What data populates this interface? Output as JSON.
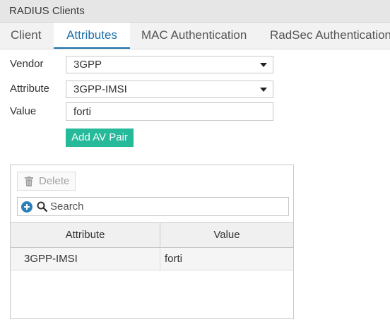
{
  "window": {
    "title": "RADIUS Clients"
  },
  "tabs": [
    {
      "label": "Client",
      "active": false
    },
    {
      "label": "Attributes",
      "active": true
    },
    {
      "label": "MAC Authentication",
      "active": false
    },
    {
      "label": "RadSec Authentication",
      "active": false
    }
  ],
  "form": {
    "vendor_label": "Vendor",
    "vendor_value": "3GPP",
    "attribute_label": "Attribute",
    "attribute_value": "3GPP-IMSI",
    "value_label": "Value",
    "value_value": "forti",
    "add_button_label": "Add AV Pair"
  },
  "table": {
    "delete_label": "Delete",
    "search_placeholder": "Search",
    "columns": [
      "Attribute",
      "Value"
    ],
    "rows": [
      {
        "attribute": "3GPP-IMSI",
        "value": "forti"
      }
    ]
  },
  "icons": {
    "delete": "trash-icon",
    "add": "plus-circle-icon",
    "search": "search-icon",
    "dropdown": "chevron-down-icon"
  },
  "colors": {
    "accent": "#1a6fa8",
    "add_button": "#26b99a",
    "add_icon": "#2d7fb8"
  }
}
